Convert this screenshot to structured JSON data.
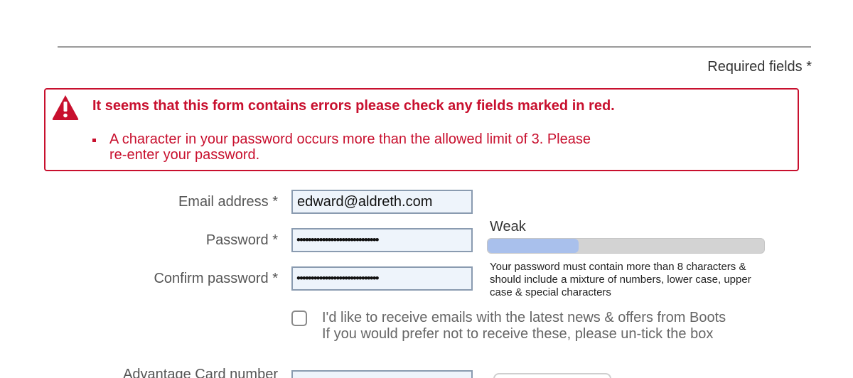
{
  "header": {
    "required_note": "Required fields *"
  },
  "error_panel": {
    "icon": "warning-triangle-icon",
    "title": "It seems that this form contains errors please check any fields marked in red.",
    "items": [
      "A character in your password occurs more than the allowed limit of 3. Please re-enter your password."
    ],
    "color": "#c8102e"
  },
  "form": {
    "email": {
      "label": "Email address *",
      "value": "edward@aldreth.com"
    },
    "password": {
      "label": "Password *",
      "value": "•••••••••••••••••••••••••••••"
    },
    "confirm_password": {
      "label": "Confirm password *",
      "value": "•••••••••••••••••••••••••••••"
    },
    "strength": {
      "label": "Weak",
      "level_fraction": 0.33,
      "fill_color": "#a9c0ec",
      "track_color": "#d3d3d3"
    },
    "password_hint": "Your password must contain more than 8 characters & should include a mixture of numbers, lower case, upper case & special characters",
    "marketing_opt_in": {
      "checked": false,
      "line1": "I'd like to receive emails with the latest news & offers from Boots",
      "line2": "If you would prefer not to receive these, please un-tick the box"
    },
    "advantage_card": {
      "label": "Advantage Card number"
    }
  }
}
